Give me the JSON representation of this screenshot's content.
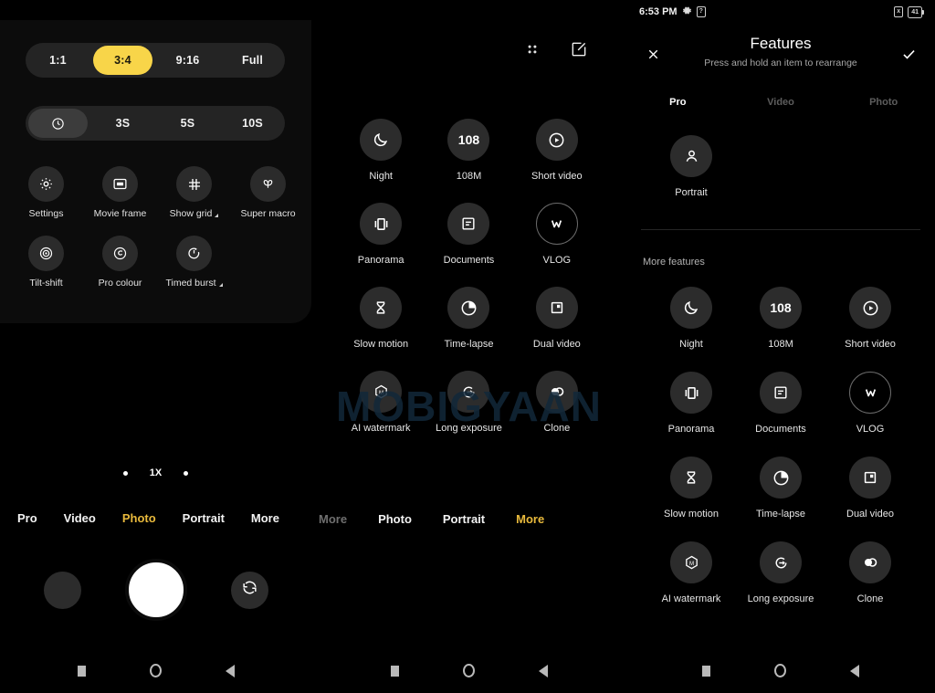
{
  "left_phone": {
    "aspect_ratio": {
      "options": [
        "1:1",
        "3:4",
        "9:16",
        "Full"
      ],
      "selected": "3:4"
    },
    "timer": {
      "options": [
        "timer-icon",
        "3S",
        "5S",
        "10S"
      ],
      "selected": "timer-icon"
    },
    "tools": [
      {
        "label": "Settings",
        "icon": "settings-gear-icon",
        "has_caret": false
      },
      {
        "label": "Movie frame",
        "icon": "movie-frame-icon",
        "has_caret": false
      },
      {
        "label": "Show grid",
        "icon": "grid-icon",
        "has_caret": true
      },
      {
        "label": "Super macro",
        "icon": "macro-flower-icon",
        "has_caret": false
      },
      {
        "label": "Tilt-shift",
        "icon": "tilt-shift-icon",
        "has_caret": false
      },
      {
        "label": "Pro colour",
        "icon": "pro-colour-icon",
        "has_caret": false
      },
      {
        "label": "Timed burst",
        "icon": "timed-burst-icon",
        "has_caret": true
      }
    ],
    "zoom": {
      "value": "1X"
    },
    "modes": [
      {
        "label": "Pro",
        "state": "normal"
      },
      {
        "label": "Video",
        "state": "normal"
      },
      {
        "label": "Photo",
        "state": "selected"
      },
      {
        "label": "Portrait",
        "state": "normal"
      },
      {
        "label": "More",
        "state": "normal"
      }
    ],
    "shutter": {
      "thumbnail": "gallery-thumbnail",
      "capture": "shutter-button",
      "flip": "flip-camera-icon"
    }
  },
  "mid_phone": {
    "top_icons": [
      {
        "name": "apps-grid-icon"
      },
      {
        "name": "edit-square-icon"
      }
    ],
    "features": [
      {
        "label": "Night",
        "icon": "moon-icon",
        "hollow": false
      },
      {
        "label": "108M",
        "icon": "108-text-icon",
        "hollow": false
      },
      {
        "label": "Short video",
        "icon": "play-circle-icon",
        "hollow": false
      },
      {
        "label": "Panorama",
        "icon": "panorama-icon",
        "hollow": false
      },
      {
        "label": "Documents",
        "icon": "document-icon",
        "hollow": false
      },
      {
        "label": "VLOG",
        "icon": "vlog-v-icon",
        "hollow": true
      },
      {
        "label": "Slow motion",
        "icon": "hourglass-icon",
        "hollow": false
      },
      {
        "label": "Time-lapse",
        "icon": "timelapse-icon",
        "hollow": false
      },
      {
        "label": "Dual video",
        "icon": "dual-video-icon",
        "hollow": false
      },
      {
        "label": "AI watermark",
        "icon": "ai-watermark-icon",
        "hollow": false
      },
      {
        "label": "Long exposure",
        "icon": "long-exposure-icon",
        "hollow": false
      },
      {
        "label": "Clone",
        "icon": "clone-icon",
        "hollow": false
      }
    ],
    "watermark": "MOBIGYAAN",
    "modes": [
      {
        "label": "More",
        "state": "cutoff"
      },
      {
        "label": "Photo",
        "state": "normal"
      },
      {
        "label": "Portrait",
        "state": "normal"
      },
      {
        "label": "More",
        "state": "selected"
      }
    ]
  },
  "right_phone": {
    "status_bar": {
      "time": "6:53 PM",
      "gear_icon": "gear-icon",
      "help_icon": "help-box-icon",
      "mute_icon": "mute-box-icon",
      "battery": "41"
    },
    "header": {
      "close_icon": "close-x-icon",
      "title": "Features",
      "subtitle": "Press and hold an item to rearrange",
      "confirm_icon": "check-icon"
    },
    "tabs": [
      {
        "label": "Pro",
        "state": "on"
      },
      {
        "label": "Video",
        "state": "off"
      },
      {
        "label": "Photo",
        "state": "off"
      }
    ],
    "current_items": [
      {
        "label": "Portrait",
        "icon": "person-icon",
        "hollow": false
      }
    ],
    "more_features_label": "More features",
    "more_features": [
      {
        "label": "Night",
        "icon": "moon-icon",
        "hollow": false
      },
      {
        "label": "108M",
        "icon": "108-text-icon",
        "hollow": false
      },
      {
        "label": "Short video",
        "icon": "play-circle-icon",
        "hollow": false
      },
      {
        "label": "Panorama",
        "icon": "panorama-icon",
        "hollow": false
      },
      {
        "label": "Documents",
        "icon": "document-icon",
        "hollow": false
      },
      {
        "label": "VLOG",
        "icon": "vlog-v-icon",
        "hollow": true
      },
      {
        "label": "Slow motion",
        "icon": "hourglass-icon",
        "hollow": false
      },
      {
        "label": "Time-lapse",
        "icon": "timelapse-icon",
        "hollow": false
      },
      {
        "label": "Dual video",
        "icon": "dual-video-icon",
        "hollow": false
      },
      {
        "label": "AI watermark",
        "icon": "ai-watermark-icon",
        "hollow": false
      },
      {
        "label": "Long exposure",
        "icon": "long-exposure-icon",
        "hollow": false
      },
      {
        "label": "Clone",
        "icon": "clone-icon",
        "hollow": false
      }
    ]
  },
  "nav_bar": {
    "recents_icon": "recents-square-icon",
    "home_icon": "home-circle-icon",
    "back_icon": "back-triangle-icon"
  },
  "colors": {
    "accent_yellow": "#f8d549",
    "mode_selected": "#e8b93c",
    "surface": "#2c2c2c",
    "background": "#000000"
  }
}
